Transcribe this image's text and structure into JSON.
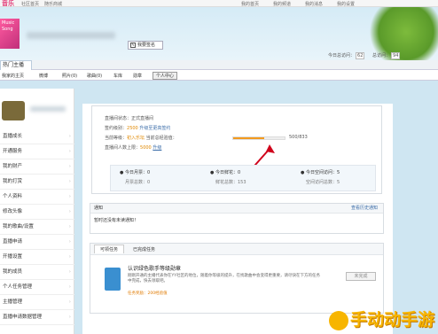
{
  "topbar": {
    "logo": "音乐",
    "links": [
      "社区首页",
      "随乐商城"
    ],
    "right_links": [
      "我的首页",
      "我的频道",
      "我的消息",
      "我的设置"
    ]
  },
  "header": {
    "badge_text": "Music Song",
    "edit_button": "我要签名",
    "stats": [
      {
        "label": "今日总访问：",
        "value": "62"
      },
      {
        "label": "总访问：",
        "value": "94"
      }
    ]
  },
  "nav": {
    "active_tab": "热门主播"
  },
  "subnav": {
    "items": [
      "我家的主页",
      "微博",
      "照片(0)",
      "歌曲(0)",
      "车库",
      "勋章"
    ],
    "active": "个人中心"
  },
  "sidebar": {
    "items": [
      "直播成长",
      "开通服务",
      "我的财产",
      "我的打赏",
      "个人资料",
      "修改头像",
      "我的歌曲/设置",
      "直播申请",
      "开播设置",
      "我的成员",
      "个人任务管理",
      "主播管理",
      "直播申请数据管理"
    ]
  },
  "status_card": {
    "lines": [
      {
        "label": "直播间状态：",
        "value": "正式直播间"
      },
      {
        "label": "签约级别：",
        "value": "2500",
        "extra": "升级至更高签约"
      },
      {
        "label": "当前等级：",
        "value": "初入乐坛",
        "extra": "当前总经验值："
      },
      {
        "label": "直播间人数上限：",
        "value": "5000",
        "extra": "升级"
      }
    ],
    "progress_text": "500/833",
    "progress": 0.6,
    "columns": [
      {
        "title": "今日月票：0",
        "sub": "月票总数：0"
      },
      {
        "title": "今日鲜花：0",
        "sub": "鲜花总数：153"
      },
      {
        "title": "今日空间访问：5",
        "sub": "空间访问总数：5"
      }
    ]
  },
  "notice": {
    "title": "通知",
    "more": "查看历史通知",
    "body": "暂时还没有未读通知！"
  },
  "tasks": {
    "tabs": [
      "可领任务",
      "已完成任务"
    ],
    "title": "认识绿色歌手等级勋章",
    "desc": "刚刚开通的主播代表你在YY社区的地位，随着你等级的提升，在找歌曲中会变得更重要，请尽快在下方的任务中完成，快去领取吧。",
    "reward": "任务奖励：200经验值",
    "button": "未完成"
  },
  "watermark": "手动动手游"
}
